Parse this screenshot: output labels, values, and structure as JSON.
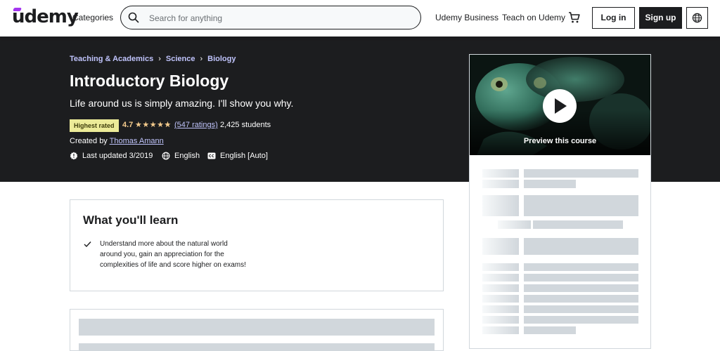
{
  "header": {
    "logo": "udemy",
    "categories": "Categories",
    "search_placeholder": "Search for anything",
    "business": "Udemy Business",
    "teach": "Teach on Udemy",
    "login": "Log in",
    "signup": "Sign up",
    "icons": [
      "search-icon",
      "cart-icon",
      "globe-icon"
    ]
  },
  "breadcrumbs": [
    "Teaching & Academics",
    "Science",
    "Biology"
  ],
  "course": {
    "title": "Introductory Biology",
    "subtitle": "Life around us is simply amazing. I'll show you why.",
    "badge": "Highest rated",
    "rating": "4.7",
    "stars": 4.7,
    "ratings_count": "(547 ratings)",
    "students": "2,425 students",
    "created_by_label": "Created by",
    "instructor": "Thomas Amann",
    "last_updated": "Last updated 3/2019",
    "language": "English",
    "captions": "English [Auto]"
  },
  "preview": {
    "label": "Preview this course"
  },
  "learn": {
    "heading": "What you'll learn",
    "items": [
      "Understand more about the natural world around you, gain an appreciation for the complexities of life and score higher on exams!"
    ]
  },
  "colors": {
    "brand_purple": "#a435f0",
    "dark_band": "#1c1d1f",
    "link_light": "#c0c4fc",
    "star": "#f3ca8c",
    "badge_bg": "#eceb98"
  }
}
